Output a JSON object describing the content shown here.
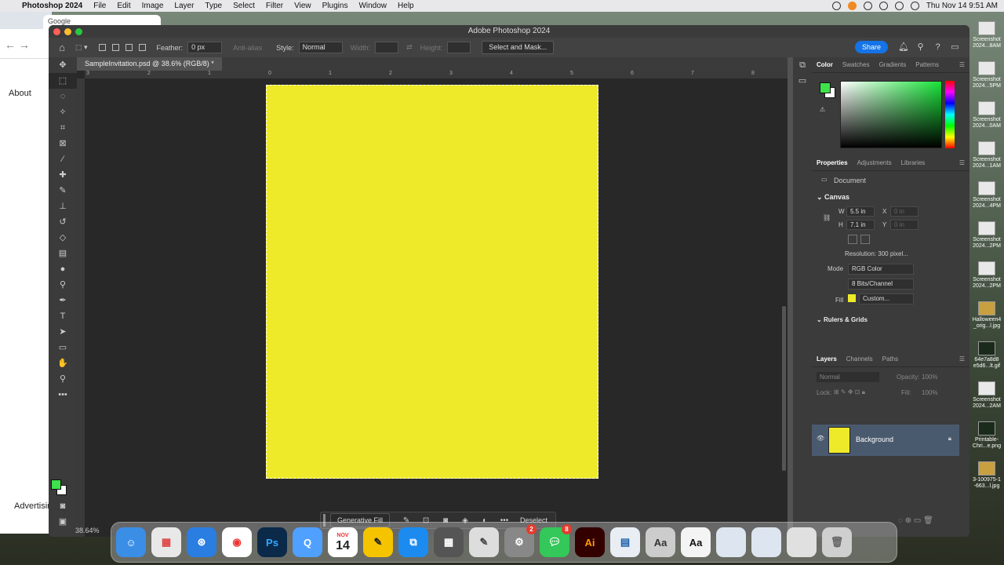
{
  "menubar": {
    "app_name": "Photoshop 2024",
    "items": [
      "File",
      "Edit",
      "Image",
      "Layer",
      "Type",
      "Select",
      "Filter",
      "View",
      "Plugins",
      "Window",
      "Help"
    ],
    "clock": "Thu Nov 14  9:51 AM"
  },
  "browser": {
    "tab_title": "Google",
    "about_link": "About",
    "advertising_link": "Advertisin"
  },
  "window": {
    "title": "Adobe Photoshop 2024"
  },
  "options_bar": {
    "feather_label": "Feather:",
    "feather_value": "0 px",
    "anti_alias_label": "Anti-alias",
    "style_label": "Style:",
    "style_value": "Normal",
    "width_label": "Width:",
    "height_label": "Height:",
    "select_mask_label": "Select and Mask...",
    "share_label": "Share"
  },
  "document": {
    "tab_title": "SampleInvitation.psd @ 38.6% (RGB/8) *",
    "zoom": "38.64%",
    "canvas_color": "#eeea2a"
  },
  "ruler": {
    "h_ticks": [
      "3",
      "2",
      "1",
      "0",
      "1",
      "2",
      "3",
      "4",
      "5",
      "6",
      "7",
      "8"
    ]
  },
  "contextual_taskbar": {
    "generative_fill_label": "Generative Fill",
    "deselect_label": "Deselect"
  },
  "color_panel": {
    "tabs": [
      "Color",
      "Swatches",
      "Gradients",
      "Patterns"
    ],
    "foreground": "#3ee24a",
    "background": "#ffffff"
  },
  "properties_panel": {
    "tabs": [
      "Properties",
      "Adjustments",
      "Libraries"
    ],
    "document_label": "Document",
    "canvas_header": "Canvas",
    "w_label": "W",
    "w_value": "5.5 in",
    "h_label": "H",
    "h_value": "7.1 in",
    "x_label": "X",
    "x_placeholder": "0 in",
    "y_label": "Y",
    "y_placeholder": "0 in",
    "resolution": "Resolution: 300 pixel...",
    "mode_label": "Mode",
    "mode_value": "RGB Color",
    "bits_value": "8 Bits/Channel",
    "fill_label": "Fill",
    "fill_value": "Custom...",
    "rulers_header": "Rulers & Grids"
  },
  "layers_panel": {
    "tabs": [
      "Layers",
      "Channels",
      "Paths"
    ],
    "blend_mode": "Normal",
    "opacity_label": "Opacity:",
    "opacity_value": "100%",
    "lock_label": "Lock:",
    "fill_label": "Fill:",
    "fill_value": "100%",
    "layer_name": "Background"
  },
  "desktop_files": [
    "Screenshot 2024...8AM",
    "Screenshot 2024...5PM",
    "Screenshot 2024...0AM",
    "Screenshot 2024...1AM",
    "Screenshot 2024...4PM",
    "Screenshot 2024...2PM",
    "Screenshot 2024...2PM",
    "Halloween4 _orig...l.jpg",
    "64e7a8d8 e5d6...lt.gif",
    "Screenshot 2024...2AM",
    "Printable-Chri...e.png",
    "3-100975-1 -663...l.jpg"
  ],
  "dock": {
    "calendar_month": "NOV",
    "calendar_day": "14",
    "settings_badge": "2",
    "messages_badge": "8",
    "photoshop_label": "Ps",
    "illustrator_label": "Ai",
    "font_label": "Aa"
  }
}
